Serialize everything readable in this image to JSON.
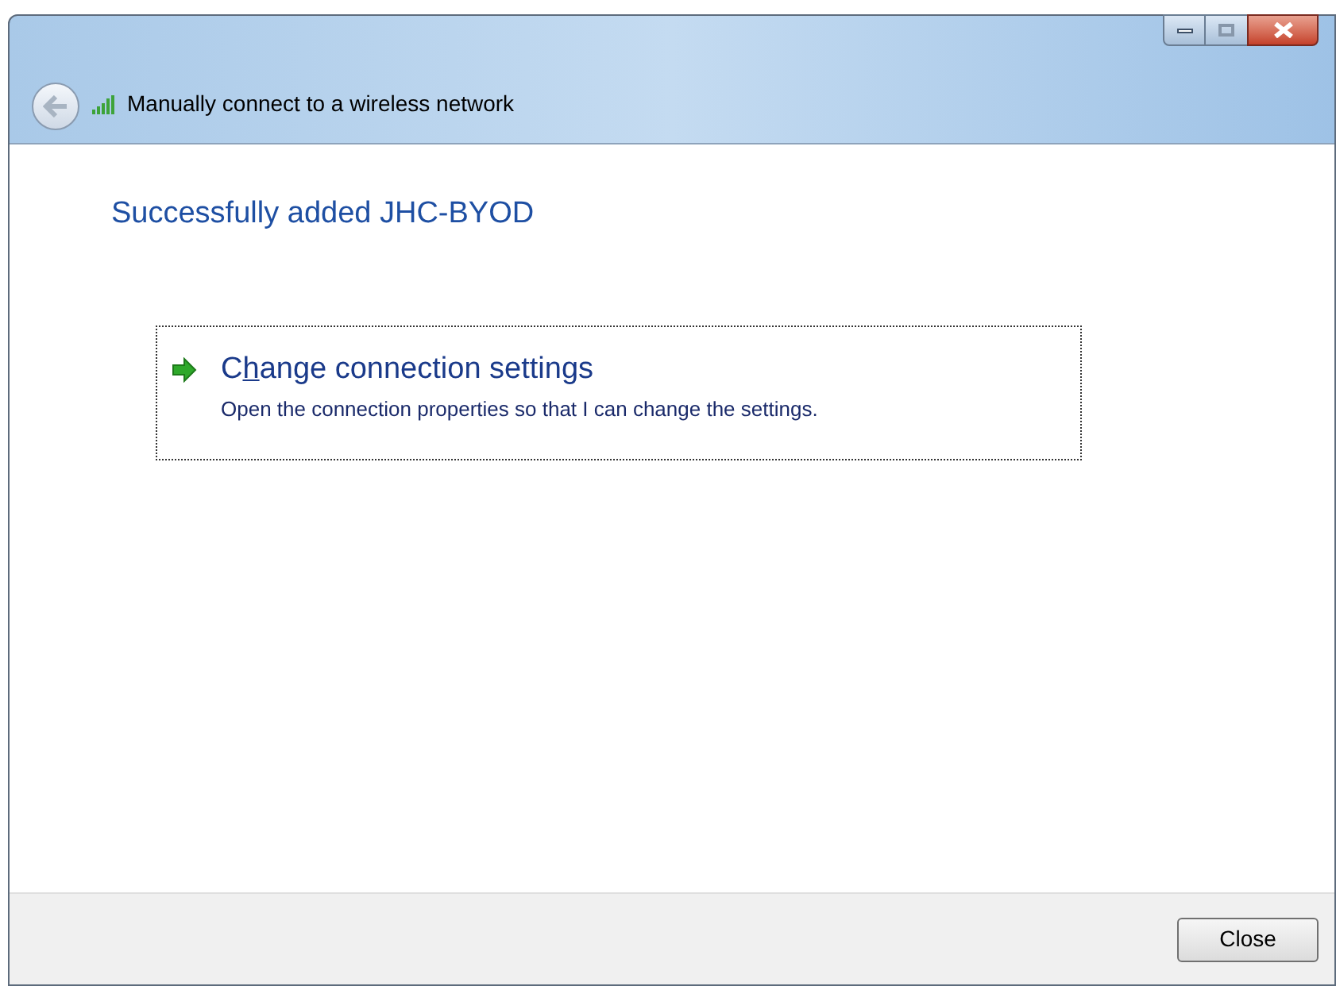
{
  "window": {
    "title": "Manually connect to a wireless network"
  },
  "heading": "Successfully added JHC-BYOD",
  "options": [
    {
      "title": [
        {
          "text": "C",
          "underlined": false
        },
        {
          "text": "h",
          "underlined": true
        },
        {
          "text": "ange connection settings",
          "underlined": false
        }
      ],
      "description": "Open the connection properties so that I can change the settings.",
      "focused": true
    }
  ],
  "buttons": [
    "Close"
  ]
}
